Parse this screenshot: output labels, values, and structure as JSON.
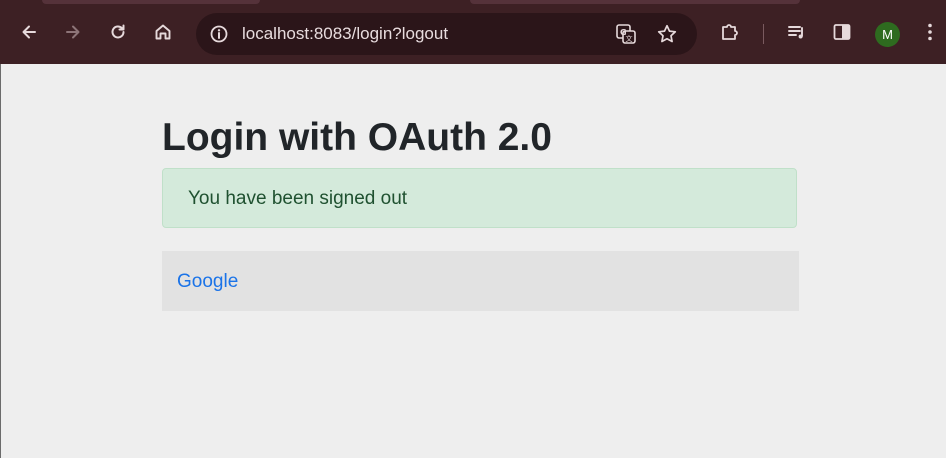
{
  "browser": {
    "url": "localhost:8083/login?logout",
    "profile_initial": "M",
    "icons": {
      "back": "arrow-left-icon",
      "forward": "arrow-right-icon",
      "reload": "reload-icon",
      "home": "home-icon",
      "site_info": "info-icon",
      "translate": "translate-icon",
      "bookmark": "star-icon",
      "extensions": "puzzle-icon",
      "media": "media-queue-icon",
      "side_panel": "side-panel-icon",
      "menu": "kebab-menu-icon"
    },
    "colors": {
      "toolbar": "#3d2024",
      "omnibox": "#2b1519",
      "avatar": "#2e6b1f"
    }
  },
  "page": {
    "title": "Login with OAuth 2.0",
    "alert": {
      "message": "You have been signed out",
      "type": "success"
    },
    "providers": [
      {
        "label": "Google"
      }
    ],
    "colors": {
      "background": "#eeeeee",
      "alert_bg": "#d4eadb",
      "alert_text": "#1f5130",
      "link": "#1a73e8"
    }
  }
}
